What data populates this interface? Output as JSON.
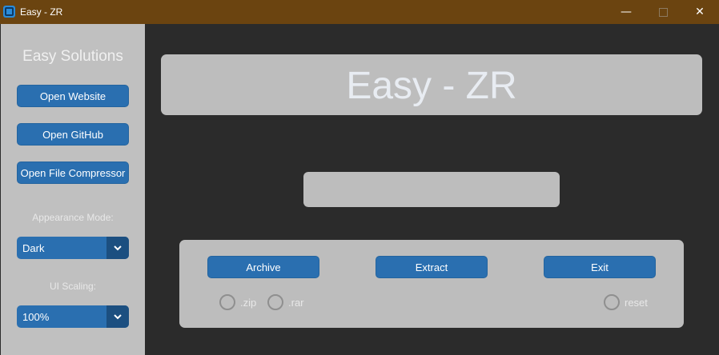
{
  "window": {
    "title": "Easy - ZR",
    "controls": {
      "minimize": "—",
      "close": "✕"
    }
  },
  "sidebar": {
    "title": "Easy Solutions",
    "buttons": [
      {
        "label": "Open Website"
      },
      {
        "label": "Open GitHub"
      },
      {
        "label": "Open File Compressor"
      }
    ],
    "appearance_label": "Appearance Mode:",
    "appearance_value": "Dark",
    "scaling_label": "UI Scaling:",
    "scaling_value": "100%"
  },
  "main": {
    "header_title": "Easy - ZR",
    "entry": {
      "value": "",
      "placeholder": ""
    },
    "actions": {
      "archive_label": "Archive",
      "extract_label": "Extract",
      "exit_label": "Exit"
    },
    "radios": {
      "zip_label": ".zip",
      "rar_label": ".rar",
      "reset_label": "reset"
    }
  },
  "colors": {
    "titlebar": "#6b4410",
    "background": "#2b2b2b",
    "panel": "#bdbdbd",
    "button": "#2a6fb0",
    "dropdown_arrow_bg": "#1c4f80"
  },
  "icons": {
    "app": "app-logo-icon",
    "minimize": "minimize-icon",
    "maximize": "maximize-icon",
    "close": "close-icon",
    "dropdown": "chevron-down-icon"
  }
}
